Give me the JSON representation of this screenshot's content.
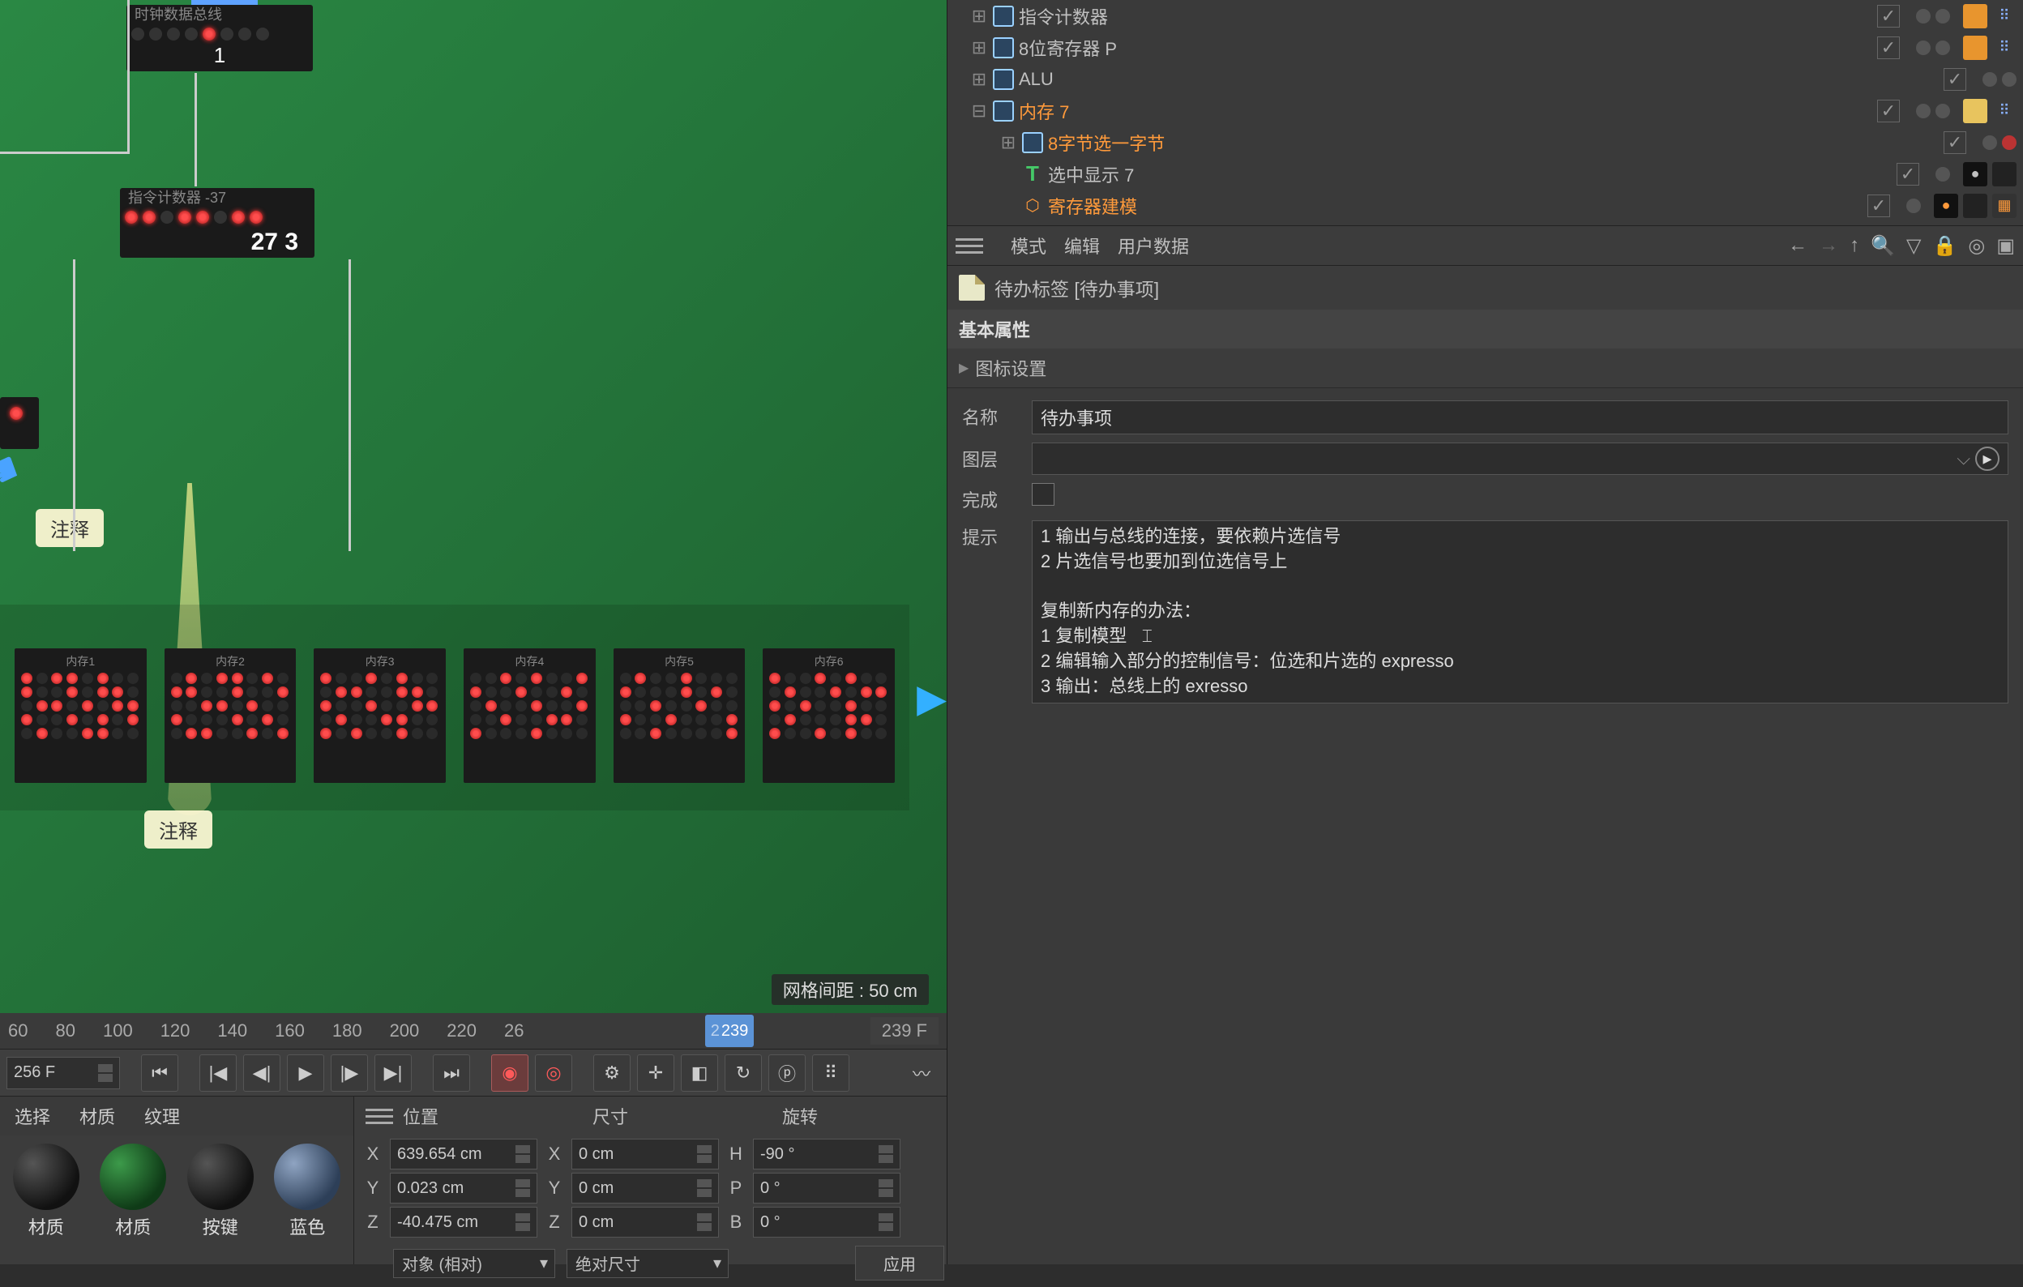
{
  "viewport": {
    "grid_label": "网格间距 : 50 cm",
    "chip_top_label": "时钟数据总线",
    "chip_top_num": "1",
    "chip_mid_label": "指令计数器  -37",
    "chip_mid_nums": "27   3",
    "mem_blocks": [
      "内存1",
      "内存2",
      "内存3",
      "内存4",
      "内存5",
      "内存6"
    ],
    "annot1": "注释",
    "annot2": "注释",
    "bubble": "注释"
  },
  "timeline": {
    "ticks": [
      "60",
      "80",
      "100",
      "120",
      "140",
      "160",
      "180",
      "200",
      "220",
      "",
      "26"
    ],
    "playhead": "239",
    "playhead_pre": "2",
    "end_frame": "239 F"
  },
  "playbar": {
    "frame_field": "256 F"
  },
  "materials": {
    "tabs": [
      "选择",
      "材质",
      "纹理"
    ],
    "items": [
      {
        "label": "材质",
        "kind": "dark"
      },
      {
        "label": "材质",
        "kind": "green"
      },
      {
        "label": "按键",
        "kind": "dark"
      },
      {
        "label": "蓝色",
        "kind": "blue"
      }
    ]
  },
  "coords": {
    "headers": [
      "位置",
      "尺寸",
      "旋转"
    ],
    "rows": [
      {
        "a": "X",
        "av": "639.654 cm",
        "b": "X",
        "bv": "0 cm",
        "c": "H",
        "cv": "-90 °"
      },
      {
        "a": "Y",
        "av": "0.023 cm",
        "b": "Y",
        "bv": "0 cm",
        "c": "P",
        "cv": "0 °"
      },
      {
        "a": "Z",
        "av": "-40.475 cm",
        "b": "Z",
        "bv": "0 cm",
        "c": "B",
        "cv": "0 °"
      }
    ],
    "dd1": "对象 (相对)",
    "dd2": "绝对尺寸",
    "apply": "应用"
  },
  "hierarchy": [
    {
      "indent": 28,
      "toggle": "⊞",
      "icon": "null",
      "name": "指令计数器",
      "sel": false,
      "tags": [
        "orange",
        "particles"
      ]
    },
    {
      "indent": 28,
      "toggle": "⊞",
      "icon": "null",
      "name": "8位寄存器 P",
      "sel": false,
      "tags": [
        "orange",
        "particles"
      ]
    },
    {
      "indent": 28,
      "toggle": "⊞",
      "icon": "null",
      "name": "ALU",
      "sel": false,
      "tags": []
    },
    {
      "indent": 28,
      "toggle": "⊟",
      "icon": "null",
      "name": "内存 7",
      "sel": true,
      "tags": [
        "note",
        "particles"
      ]
    },
    {
      "indent": 64,
      "toggle": "⊞",
      "icon": "null",
      "name": "8字节选一字节",
      "sel": true,
      "dots": [
        "g",
        "r"
      ],
      "notree": false
    },
    {
      "indent": 64,
      "toggle": "",
      "icon": "t",
      "name": "选中显示 7",
      "sel": false,
      "dots": [
        "g"
      ],
      "extra": [
        "black",
        "dark"
      ]
    },
    {
      "indent": 64,
      "toggle": "",
      "icon": "cloner",
      "name": "寄存器建模",
      "sel": true,
      "dots": [
        "g"
      ],
      "extra": [
        "black",
        "dark",
        "check"
      ]
    }
  ],
  "attr_bar": {
    "menus": [
      "模式",
      "编辑",
      "用户数据"
    ]
  },
  "attr": {
    "title": "待办标签 [待办事项]",
    "section": "基本属性",
    "subsection": "图标设置",
    "name_label": "名称",
    "name_value": "待办事项",
    "layer_label": "图层",
    "done_label": "完成",
    "hint_label": "提示",
    "hint_text": "1 输出与总线的连接，要依赖片选信号\n2 片选信号也要加到位选信号上\n\n复制新内存的办法：\n1 复制模型\n2 编辑输入部分的控制信号：位选和片选的 expresso\n3 输出：总线上的 exresso"
  }
}
